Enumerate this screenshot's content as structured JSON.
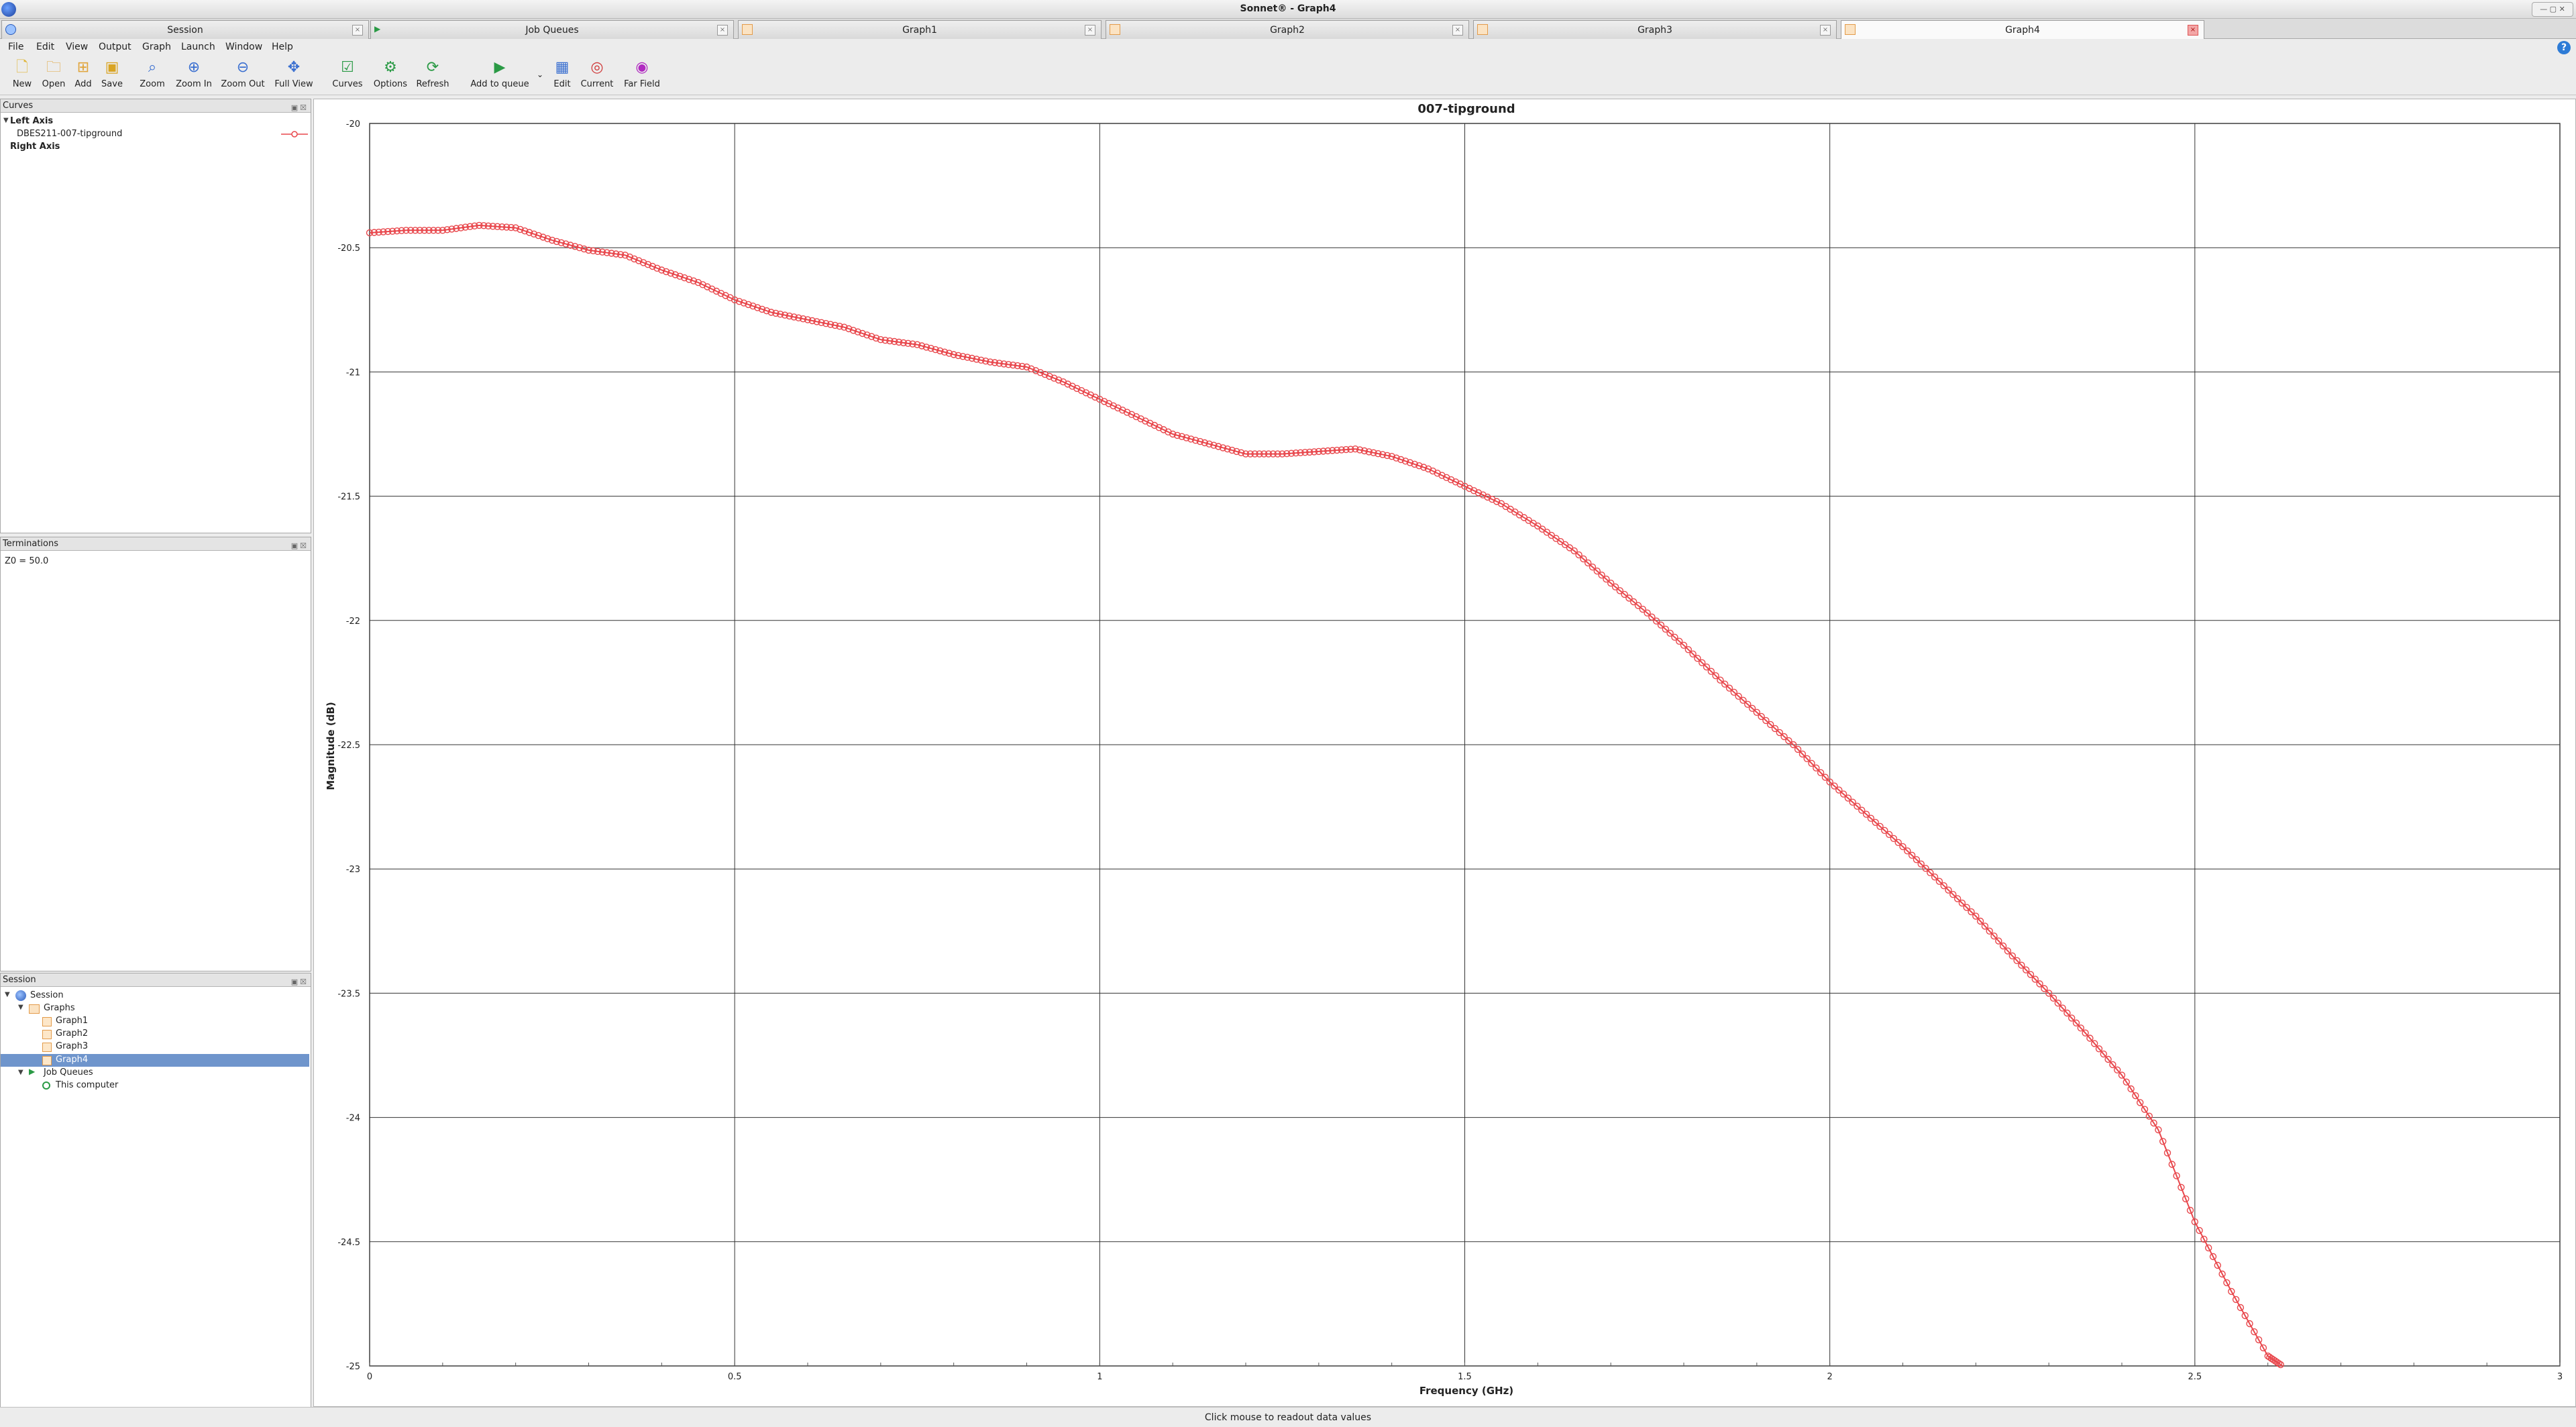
{
  "window": {
    "title": "Sonnet® - Graph4"
  },
  "tabs": [
    {
      "label": "Session"
    },
    {
      "label": "Job Queues"
    },
    {
      "label": "Graph1"
    },
    {
      "label": "Graph2"
    },
    {
      "label": "Graph3"
    },
    {
      "label": "Graph4",
      "active": true
    }
  ],
  "menu": [
    "File",
    "Edit",
    "View",
    "Output",
    "Graph",
    "Launch",
    "Window",
    "Help"
  ],
  "toolbar": {
    "new": "New",
    "open": "Open",
    "add": "Add",
    "save": "Save",
    "zoom": "Zoom",
    "zoom_in": "Zoom In",
    "zoom_out": "Zoom Out",
    "full_view": "Full View",
    "curves": "Curves",
    "options": "Options",
    "refresh": "Refresh",
    "add_to_queue": "Add to queue",
    "edit": "Edit",
    "current": "Current",
    "far_field": "Far Field"
  },
  "curves_panel": {
    "title": "Curves",
    "left_axis": "Left Axis",
    "curve_name": "DBES211-007-tipground",
    "right_axis": "Right Axis"
  },
  "terminations_panel": {
    "title": "Terminations",
    "z0": "Z0 = 50.0"
  },
  "session_panel": {
    "title": "Session",
    "root": "Session",
    "graphs": "Graphs",
    "graph_items": [
      "Graph1",
      "Graph2",
      "Graph3",
      "Graph4"
    ],
    "job_queues": "Job Queues",
    "this_computer": "This computer"
  },
  "status": "Click mouse to readout data values",
  "colors": {
    "curve": "#e8474c",
    "selection": "#6f95cc",
    "accent": "#2d7bd6"
  },
  "chart_data": {
    "type": "line",
    "title": "007-tipground",
    "xlabel": "Frequency (GHz)",
    "ylabel": "Magnitude (dB)",
    "xlim": [
      0,
      3
    ],
    "ylim": [
      -25,
      -20
    ],
    "xticks": [
      0,
      0.5,
      1,
      1.5,
      2,
      2.5,
      3
    ],
    "yticks": [
      -20,
      -20.5,
      -21,
      -21.5,
      -22,
      -22.5,
      -23,
      -23.5,
      -24,
      -24.5,
      -25
    ],
    "xtick_labels": [
      "0",
      "0.5",
      "1",
      "1.5",
      "2",
      "2.5",
      "3"
    ],
    "ytick_labels": [
      "-20",
      "-20.5",
      "-21",
      "-21.5",
      "-22",
      "-22.5",
      "-23",
      "-23.5",
      "-24",
      "-24.5",
      "-25"
    ],
    "grid": true,
    "series": [
      {
        "name": "DBES211-007-tipground",
        "marker": "circle",
        "x": [
          0,
          0.05,
          0.1,
          0.15,
          0.2,
          0.25,
          0.3,
          0.35,
          0.4,
          0.45,
          0.5,
          0.55,
          0.6,
          0.65,
          0.7,
          0.75,
          0.8,
          0.85,
          0.9,
          0.95,
          1.0,
          1.05,
          1.1,
          1.15,
          1.2,
          1.25,
          1.3,
          1.35,
          1.4,
          1.45,
          1.5,
          1.55,
          1.6,
          1.65,
          1.7,
          1.75,
          1.8,
          1.85,
          1.9,
          1.95,
          2.0,
          2.05,
          2.1,
          2.15,
          2.2,
          2.25,
          2.3,
          2.35,
          2.4,
          2.45,
          2.5,
          2.55,
          2.6,
          2.62
        ],
        "y": [
          -20.44,
          -20.43,
          -20.43,
          -20.41,
          -20.42,
          -20.47,
          -20.51,
          -20.53,
          -20.59,
          -20.64,
          -20.71,
          -20.76,
          -20.79,
          -20.82,
          -20.87,
          -20.89,
          -20.93,
          -20.96,
          -20.98,
          -21.04,
          -21.11,
          -21.18,
          -21.25,
          -21.29,
          -21.33,
          -21.33,
          -21.32,
          -21.31,
          -21.34,
          -21.39,
          -21.46,
          -21.53,
          -21.62,
          -21.72,
          -21.85,
          -21.97,
          -22.1,
          -22.24,
          -22.37,
          -22.5,
          -22.65,
          -22.78,
          -22.91,
          -23.05,
          -23.19,
          -23.35,
          -23.5,
          -23.66,
          -23.83,
          -24.05,
          -24.42,
          -24.7,
          -24.96,
          -25.0
        ]
      }
    ]
  }
}
